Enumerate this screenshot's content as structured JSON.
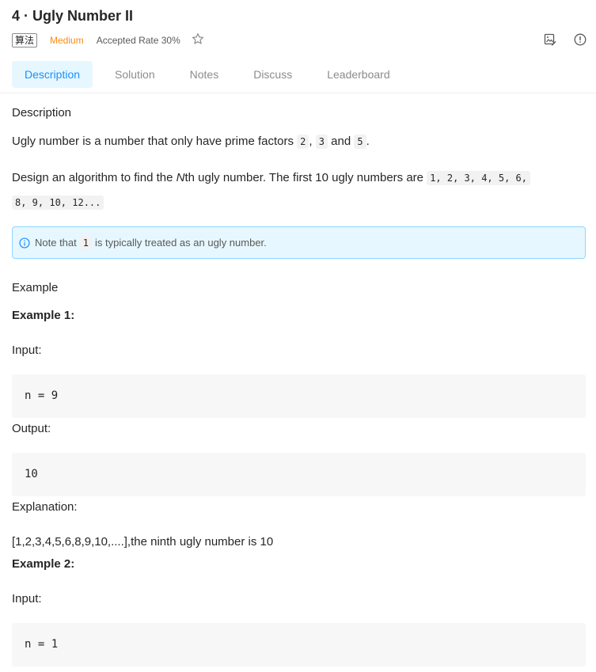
{
  "header": {
    "title": "4 · Ugly Number II",
    "tag": "算法",
    "difficulty": "Medium",
    "accepted_rate": "Accepted Rate 30%",
    "icons": [
      "star-outline-icon",
      "image-edit-icon",
      "info-circle-icon"
    ]
  },
  "tabs": [
    {
      "label": "Description",
      "active": true
    },
    {
      "label": "Solution"
    },
    {
      "label": "Notes"
    },
    {
      "label": "Discuss"
    },
    {
      "label": "Leaderboard"
    }
  ],
  "description": {
    "heading": "Description",
    "line1_pre": "Ugly number is a number that only have prime factors ",
    "factor_a": "2",
    "sep": ", ",
    "factor_b": "3",
    "and": " and ",
    "factor_c": "5",
    "end": ".",
    "line2_pre": "Design an algorithm to find the ",
    "line2_n": "N",
    "line2_mid": "th ugly number. The first 10 ugly numbers are ",
    "line2_code": "1, 2, 3, 4, 5, 6,",
    "line3_code": "8, 9, 10, 12..."
  },
  "note": {
    "pre": "Note that ",
    "code": "1",
    "post": " is typically treated as an ugly number."
  },
  "example": {
    "heading": "Example",
    "ex1_title": "Example 1:",
    "input_label": "Input:",
    "ex1_input": "n = 9",
    "output_label": "Output:",
    "ex1_output": "10",
    "explanation_label": "Explanation:",
    "ex1_explanation": "[1,2,3,4,5,6,8,9,10,....],the ninth ugly number is 10",
    "ex2_title": "Example 2:",
    "ex2_input_label": "Input:",
    "ex2_input": "n = 1"
  },
  "colors": {
    "accent": "#1890ff",
    "difficulty_medium": "#fa8c16",
    "note_bg": "#e6f7ff"
  }
}
